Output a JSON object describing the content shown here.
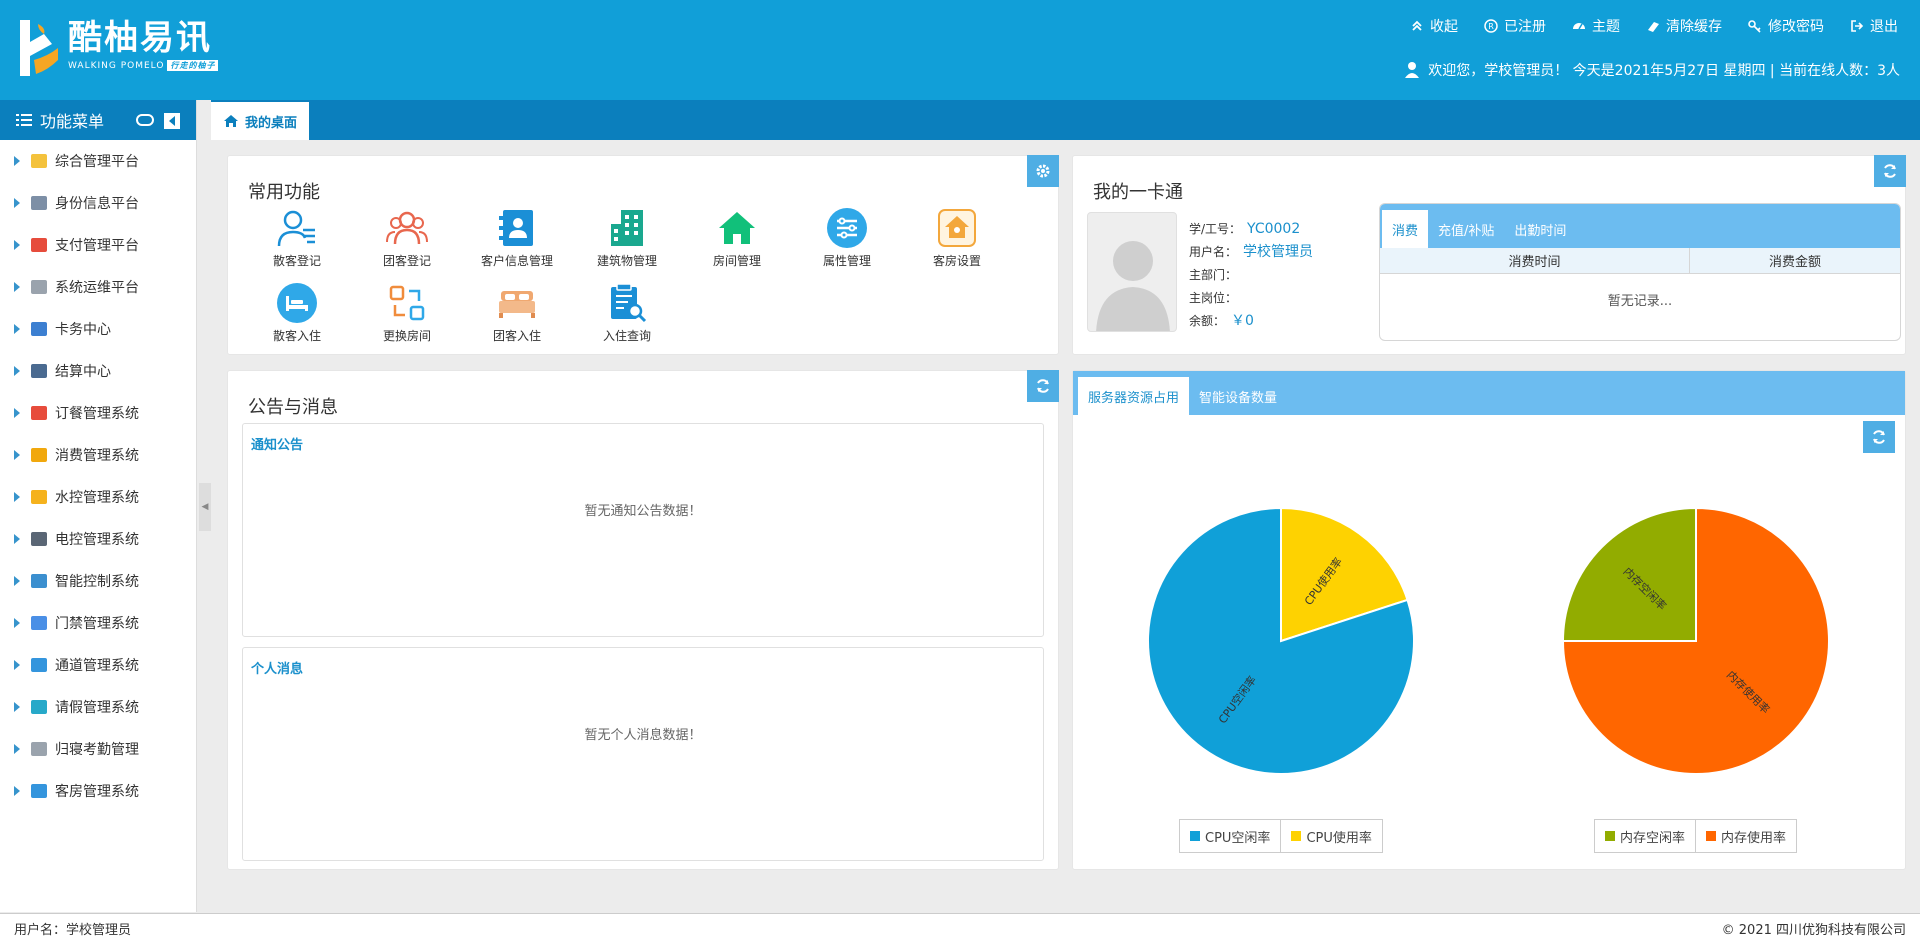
{
  "brand": {
    "name": "酷柚易讯",
    "sub": "WALKING POMELO",
    "tag": "行走的柚子"
  },
  "header": {
    "actions": [
      {
        "label": "收起",
        "icon": "double-chevron-up-icon"
      },
      {
        "label": "已注册",
        "icon": "registered-icon"
      },
      {
        "label": "主题",
        "icon": "palette-icon"
      },
      {
        "label": "清除缓存",
        "icon": "eraser-icon"
      },
      {
        "label": "修改密码",
        "icon": "key-icon"
      },
      {
        "label": "退出",
        "icon": "logout-icon"
      }
    ],
    "welcome": "欢迎您，学校管理员！ 今天是2021年5月27日 星期四 | 当前在线人数：3人"
  },
  "sidebar": {
    "title": "功能菜单",
    "items": [
      {
        "label": "综合管理平台",
        "color": "#f4c23c"
      },
      {
        "label": "身份信息平台",
        "color": "#7d8fa6"
      },
      {
        "label": "支付管理平台",
        "color": "#e64c3c"
      },
      {
        "label": "系统运维平台",
        "color": "#9aa3ad"
      },
      {
        "label": "卡务中心",
        "color": "#3c7fd1"
      },
      {
        "label": "结算中心",
        "color": "#4a6a90"
      },
      {
        "label": "订餐管理系统",
        "color": "#e74c3c"
      },
      {
        "label": "消费管理系统",
        "color": "#f1a80d"
      },
      {
        "label": "水控管理系统",
        "color": "#f5b21d"
      },
      {
        "label": "电控管理系统",
        "color": "#5a6675"
      },
      {
        "label": "智能控制系统",
        "color": "#3b8fcf"
      },
      {
        "label": "门禁管理系统",
        "color": "#4a8fe6"
      },
      {
        "label": "通道管理系统",
        "color": "#3495dd"
      },
      {
        "label": "请假管理系统",
        "color": "#27a9c9"
      },
      {
        "label": "归寝考勤管理",
        "color": "#9aa3ad"
      },
      {
        "label": "客房管理系统",
        "color": "#3495dd"
      }
    ]
  },
  "tabs": {
    "home": "我的桌面"
  },
  "common": {
    "title": "常用功能",
    "items": [
      {
        "label": "散客登记",
        "icon": "guest-register-icon"
      },
      {
        "label": "团客登记",
        "icon": "group-register-icon"
      },
      {
        "label": "客户信息管理",
        "icon": "contacts-book-icon"
      },
      {
        "label": "建筑物管理",
        "icon": "building-icon"
      },
      {
        "label": "房间管理",
        "icon": "house-icon"
      },
      {
        "label": "属性管理",
        "icon": "sliders-icon"
      },
      {
        "label": "客房设置",
        "icon": "room-settings-icon"
      },
      {
        "label": "散客入住",
        "icon": "bed-checkin-icon"
      },
      {
        "label": "更换房间",
        "icon": "swap-room-icon"
      },
      {
        "label": "团客入住",
        "icon": "group-bed-icon"
      },
      {
        "label": "入住查询",
        "icon": "search-document-icon"
      }
    ]
  },
  "card": {
    "title": "我的一卡通",
    "id_label": "学/工号：",
    "id_value": "YC0002",
    "user_label": "用户名：",
    "user_value": "学校管理员",
    "dept_label": "主部门：",
    "post_label": "主岗位：",
    "balance_label": "余额：",
    "balance_value": "￥0",
    "tabs": [
      "消费",
      "充值/补贴",
      "出勤时间"
    ],
    "columns": [
      "消费时间",
      "消费金额"
    ],
    "empty": "暂无记录..."
  },
  "notice": {
    "title": "公告与消息",
    "announce_title": "通知公告",
    "announce_empty": "暂无通知公告数据！",
    "personal_title": "个人消息",
    "personal_empty": "暂无个人消息数据！"
  },
  "server": {
    "tabs": [
      "服务器资源占用",
      "智能设备数量"
    ]
  },
  "chart_data": [
    {
      "type": "pie",
      "slices": [
        {
          "name": "CPU空闲率",
          "value": 80,
          "color": "#10a0d8"
        },
        {
          "name": "CPU使用率",
          "value": 20,
          "color": "#fed201"
        }
      ]
    },
    {
      "type": "pie",
      "slices": [
        {
          "name": "内存空闲率",
          "value": 25,
          "color": "#92ac00"
        },
        {
          "name": "内存使用率",
          "value": 75,
          "color": "#ff6600"
        }
      ]
    }
  ],
  "footer": {
    "user": "用户名：学校管理员",
    "copyright": "© 2021   四川优狗科技有限公司"
  }
}
